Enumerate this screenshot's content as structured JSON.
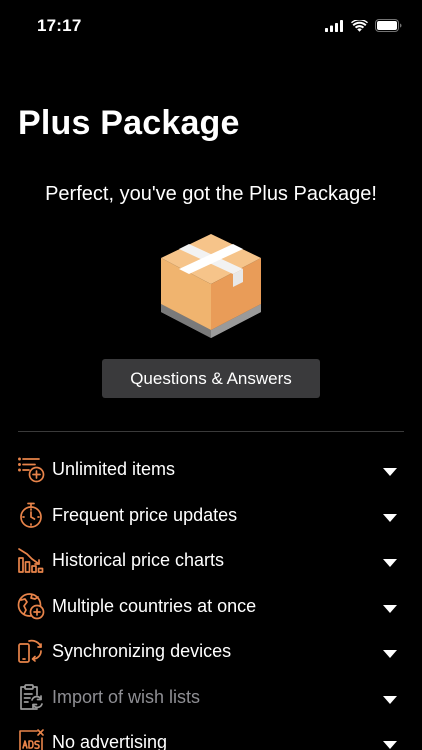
{
  "status_bar": {
    "time": "17:17"
  },
  "page": {
    "title": "Plus Package",
    "subtitle": "Perfect, you've got the Plus Package!",
    "qa_button_label": "Questions & Answers"
  },
  "features": [
    {
      "label": "Unlimited items",
      "icon": "list-plus-icon",
      "dimmed": false
    },
    {
      "label": "Frequent price updates",
      "icon": "stopwatch-icon",
      "dimmed": false
    },
    {
      "label": "Historical price charts",
      "icon": "bar-chart-trend-icon",
      "dimmed": false
    },
    {
      "label": "Multiple countries at once",
      "icon": "globe-plus-icon",
      "dimmed": false
    },
    {
      "label": "Synchronizing devices",
      "icon": "device-sync-icon",
      "dimmed": false
    },
    {
      "label": "Import of wish lists",
      "icon": "clipboard-sync-icon",
      "dimmed": true
    },
    {
      "label": "No advertising",
      "icon": "no-ads-icon",
      "dimmed": false
    }
  ],
  "colors": {
    "background": "#000000",
    "accent": "#e8844a",
    "button_bg": "#3a3a3c",
    "muted_text": "#8e8e93"
  }
}
